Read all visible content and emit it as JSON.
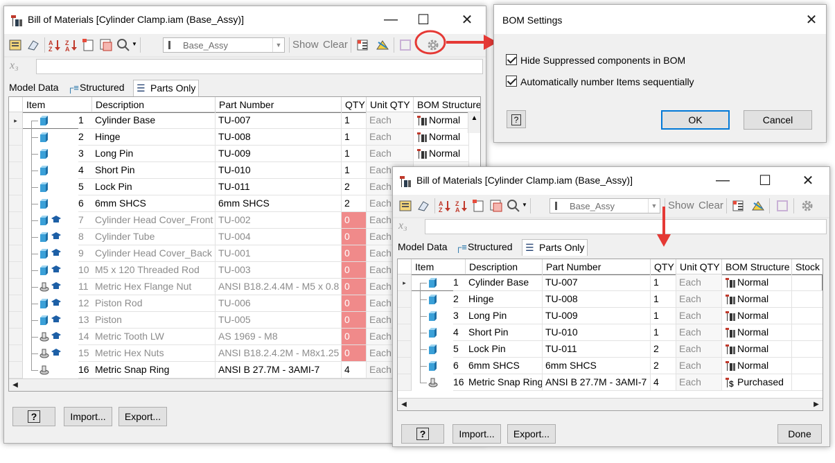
{
  "win1": {
    "title": "Bill of Materials [Cylinder Clamp.iam (Base_Assy)]",
    "combo": "Base_Assy",
    "show": "Show",
    "clear": "Clear",
    "tabs": [
      "Model Data",
      "Structured",
      "Parts Only"
    ],
    "headers": [
      "Item",
      "Description",
      "Part Number",
      "QTY",
      "Unit QTY",
      "BOM Structure"
    ],
    "rows": [
      {
        "n": "1",
        "desc": "Cylinder Base",
        "pn": "TU-007",
        "qty": "1",
        "unit": "Each",
        "bom": "Normal",
        "grey": false,
        "hat": false,
        "kind": "part"
      },
      {
        "n": "2",
        "desc": "Hinge",
        "pn": "TU-008",
        "qty": "1",
        "unit": "Each",
        "bom": "Normal",
        "grey": false,
        "hat": false,
        "kind": "part"
      },
      {
        "n": "3",
        "desc": "Long Pin",
        "pn": "TU-009",
        "qty": "1",
        "unit": "Each",
        "bom": "Normal",
        "grey": false,
        "hat": false,
        "kind": "part"
      },
      {
        "n": "4",
        "desc": "Short Pin",
        "pn": "TU-010",
        "qty": "1",
        "unit": "Each",
        "bom": "",
        "grey": false,
        "hat": false,
        "kind": "part"
      },
      {
        "n": "5",
        "desc": "Lock Pin",
        "pn": "TU-011",
        "qty": "2",
        "unit": "Each",
        "bom": "",
        "grey": false,
        "hat": false,
        "kind": "part"
      },
      {
        "n": "6",
        "desc": "6mm SHCS",
        "pn": "6mm SHCS",
        "qty": "2",
        "unit": "Each",
        "bom": "",
        "grey": false,
        "hat": false,
        "kind": "part"
      },
      {
        "n": "7",
        "desc": "Cylinder Head Cover_Front",
        "pn": "TU-002",
        "qty": "0",
        "unit": "Each",
        "bom": "",
        "grey": true,
        "hat": true,
        "kind": "part"
      },
      {
        "n": "8",
        "desc": "Cylinder Tube",
        "pn": "TU-004",
        "qty": "0",
        "unit": "Each",
        "bom": "",
        "grey": true,
        "hat": true,
        "kind": "part"
      },
      {
        "n": "9",
        "desc": "Cylinder Head Cover_Back",
        "pn": "TU-001",
        "qty": "0",
        "unit": "Each",
        "bom": "",
        "grey": true,
        "hat": true,
        "kind": "part"
      },
      {
        "n": "10",
        "desc": "M5 x 120 Threaded Rod",
        "pn": "TU-003",
        "qty": "0",
        "unit": "Each",
        "bom": "",
        "grey": true,
        "hat": true,
        "kind": "part"
      },
      {
        "n": "11",
        "desc": "Metric Hex Flange Nut",
        "pn": "ANSI B18.2.4.4M - M5 x 0.8",
        "qty": "0",
        "unit": "Each",
        "bom": "",
        "grey": true,
        "hat": true,
        "kind": "lib"
      },
      {
        "n": "12",
        "desc": "Piston Rod",
        "pn": "TU-006",
        "qty": "0",
        "unit": "Each",
        "bom": "",
        "grey": true,
        "hat": true,
        "kind": "part"
      },
      {
        "n": "13",
        "desc": "Piston",
        "pn": "TU-005",
        "qty": "0",
        "unit": "Each",
        "bom": "",
        "grey": true,
        "hat": true,
        "kind": "part"
      },
      {
        "n": "14",
        "desc": "Metric Tooth LW",
        "pn": "AS 1969 - M8",
        "qty": "0",
        "unit": "Each",
        "bom": "",
        "grey": true,
        "hat": true,
        "kind": "lib"
      },
      {
        "n": "15",
        "desc": "Metric Hex Nuts",
        "pn": "ANSI B18.2.4.2M - M8x1.25",
        "qty": "0",
        "unit": "Each",
        "bom": "",
        "grey": true,
        "hat": true,
        "kind": "lib"
      },
      {
        "n": "16",
        "desc": "Metric Snap Ring",
        "pn": "ANSI B 27.7M - 3AMI-7",
        "qty": "4",
        "unit": "Each",
        "bom": "",
        "grey": false,
        "hat": false,
        "kind": "lib"
      }
    ],
    "buttons": {
      "help": "?",
      "import": "Import...",
      "export": "Export..."
    }
  },
  "settings": {
    "title": "BOM Settings",
    "opt1": "Hide Suppressed components in BOM",
    "opt2": "Automatically number Items sequentially",
    "help": "?",
    "ok": "OK",
    "cancel": "Cancel"
  },
  "win2": {
    "title": "Bill of Materials [Cylinder Clamp.iam (Base_Assy)]",
    "combo": "Base_Assy",
    "show": "Show",
    "clear": "Clear",
    "tabs": [
      "Model Data",
      "Structured",
      "Parts Only"
    ],
    "headers": [
      "Item",
      "Description",
      "Part Number",
      "QTY",
      "Unit QTY",
      "BOM Structure",
      "Stock N"
    ],
    "rows": [
      {
        "n": "1",
        "desc": "Cylinder Base",
        "pn": "TU-007",
        "qty": "1",
        "unit": "Each",
        "bom": "Normal",
        "kind": "part"
      },
      {
        "n": "2",
        "desc": "Hinge",
        "pn": "TU-008",
        "qty": "1",
        "unit": "Each",
        "bom": "Normal",
        "kind": "part"
      },
      {
        "n": "3",
        "desc": "Long Pin",
        "pn": "TU-009",
        "qty": "1",
        "unit": "Each",
        "bom": "Normal",
        "kind": "part"
      },
      {
        "n": "4",
        "desc": "Short Pin",
        "pn": "TU-010",
        "qty": "1",
        "unit": "Each",
        "bom": "Normal",
        "kind": "part"
      },
      {
        "n": "5",
        "desc": "Lock Pin",
        "pn": "TU-011",
        "qty": "2",
        "unit": "Each",
        "bom": "Normal",
        "kind": "part"
      },
      {
        "n": "6",
        "desc": "6mm SHCS",
        "pn": "6mm SHCS",
        "qty": "2",
        "unit": "Each",
        "bom": "Normal",
        "kind": "part"
      },
      {
        "n": "16",
        "desc": "Metric Snap Ring",
        "pn": "ANSI B 27.7M - 3AMI-7",
        "qty": "4",
        "unit": "Each",
        "bom": "Purchased",
        "kind": "lib"
      }
    ],
    "buttons": {
      "help": "?",
      "import": "Import...",
      "export": "Export...",
      "done": "Done"
    }
  },
  "colors": {
    "highlight": "#e53935",
    "zero_qty": "#f08a8a",
    "part_icon": "#3aa0d8"
  }
}
